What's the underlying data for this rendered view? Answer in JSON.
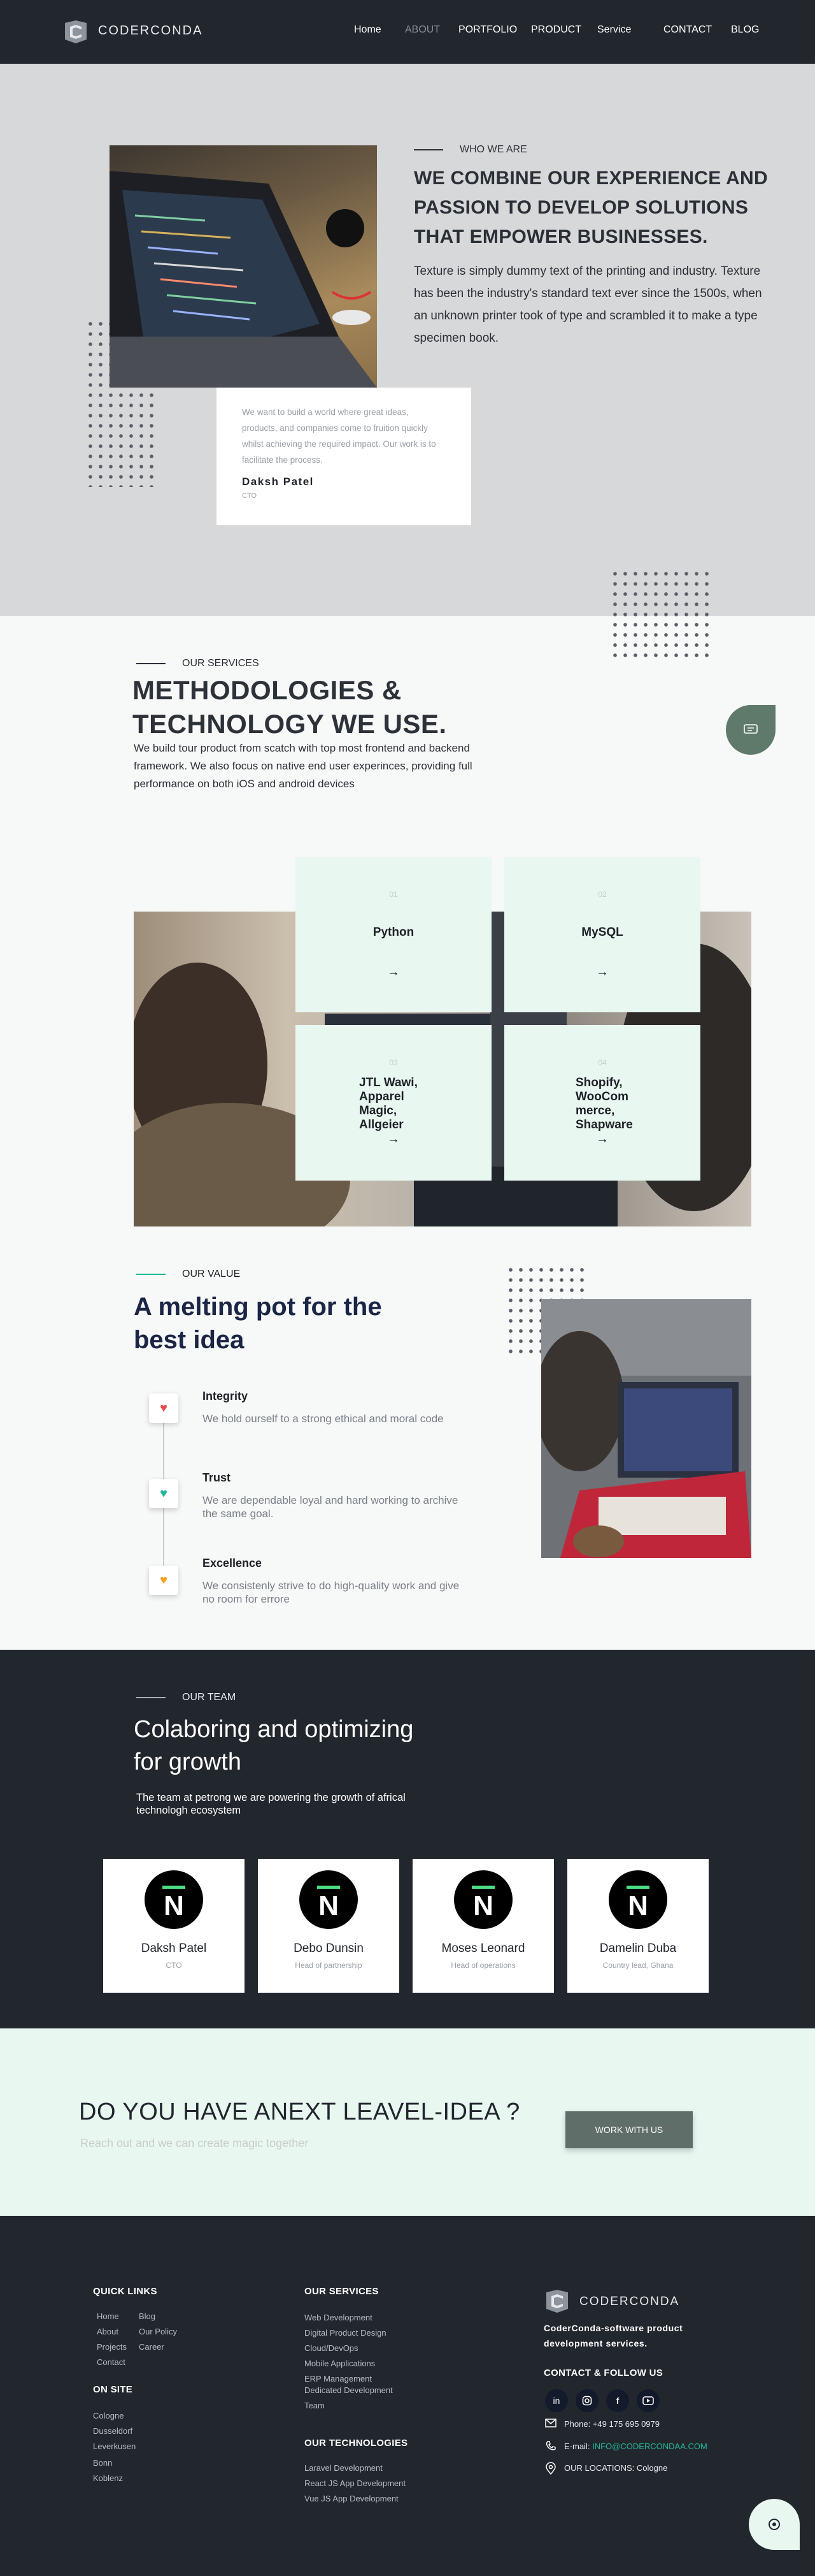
{
  "header": {
    "brand": "CODERCONDA",
    "nav": [
      "Home",
      "ABOUT",
      "PORTFOLIO",
      "PRODUCT",
      "Service",
      "CONTACT",
      "BLOG"
    ]
  },
  "who": {
    "eyebrow": "WHO WE ARE",
    "title": "WE COMBINE OUR EXPERIENCE AND PASSION TO DEVELOP SOLUTIONS THAT EMPOWER BUSINESSES.",
    "text": "Texture is simply dummy text of the printing and industry. Texture has been the industry's standard text ever since the 1500s, when an unknown printer took of type and scrambled it to make a type specimen book.",
    "quote": "We want to build a world where great ideas, products, and companies come to fruition quickly whilst achieving the required impact. Our work is to facilitate the process.",
    "quote_author": "Daksh Patel",
    "quote_role": "CTO"
  },
  "services": {
    "eyebrow": "OUR SERVICES",
    "title": "METHODOLOGIES & TECHNOLOGY WE USE.",
    "text": "We  build tour product from scatch with top most frontend and backend framework. We also focus on native end user experinces, providing full performance on both iOS and android devices",
    "cards": [
      {
        "num": "01",
        "label": "Python",
        "arrow": "→"
      },
      {
        "num": "02",
        "label": "MySQL",
        "arrow": "→"
      },
      {
        "num": "03",
        "label": "JTL  Wawi, Apparel Magic, Allgeier",
        "arrow": "→"
      },
      {
        "num": "04",
        "label": "Shopify, WooCom merce, Shapware",
        "arrow": "→"
      }
    ]
  },
  "value": {
    "eyebrow": "OUR VALUE",
    "title": "A melting pot for the best idea",
    "items": [
      {
        "title": "Integrity",
        "text": "We hold ourself to a strong ethical and moral code",
        "icon": "heart-icon",
        "color": "#e84b4b"
      },
      {
        "title": "Trust",
        "text": "We are dependable loyal and hard working to archive the same goal.",
        "icon": "heart-icon",
        "color": "#22b89a"
      },
      {
        "title": "Excellence",
        "text": "We consistenly strive to do high-quality work and give no room for errore",
        "icon": "heart-icon",
        "color": "#f0a21e"
      }
    ]
  },
  "team": {
    "eyebrow": "OUR TEAM",
    "title": "Colaboring and optimizing for growth",
    "text": "The team at petrong we are powering the growth of africal technologh ecosystem",
    "members": [
      {
        "name": "Daksh Patel",
        "role": "CTO"
      },
      {
        "name": "Debo Dunsin",
        "role": "Head of partnership"
      },
      {
        "name": "Moses Leonard",
        "role": "Head of operations"
      },
      {
        "name": "Damelin Duba",
        "role": "Country lead, Ghana"
      }
    ]
  },
  "cta": {
    "title": "DO YOU HAVE ANEXT LEAVEL-IDEA ?",
    "subtitle": "Reach out and we can create magic together",
    "button": "WORK WITH US"
  },
  "footer": {
    "quick_links_title": "QUICK LINKS",
    "quick_links_col1": [
      "Home",
      "About",
      "Projects",
      "Contact"
    ],
    "quick_links_col2": [
      "Blog",
      "Our Policy",
      "Career"
    ],
    "on_site_title": "ON SITE",
    "on_site": [
      "Cologne",
      "Dusseldorf",
      "Leverkusen",
      "Bonn",
      "Koblenz"
    ],
    "services_title": "OUR SERVICES",
    "services": [
      "Web Development",
      "Digital Product Design",
      "Cloud/DevOps",
      "Mobile Applications",
      "ERP Management",
      "Dedicated Development",
      "Team"
    ],
    "tech_title": "OUR TECHNOLOGIES",
    "tech": [
      "Laravel Development",
      "React JS App Development",
      "Vue JS App Development"
    ],
    "brand": "CODERCONDA",
    "tagline": "CoderConda-software product development services.",
    "contact_title": "CONTACT & FOLLOW US",
    "phone": "Phone: +49 175 695 0979",
    "email_label": "E-mail:",
    "email": "INFO@CODERCONDAA.COM",
    "location": "OUR LOCATIONS: Cologne",
    "social": [
      "linkedin-icon",
      "instagram-icon",
      "facebook-icon",
      "youtube-icon"
    ]
  },
  "colors": {
    "dark": "#22262d",
    "mint": "#e9f7f1",
    "accent": "#22b89a",
    "sage": "#5f7a6b"
  }
}
